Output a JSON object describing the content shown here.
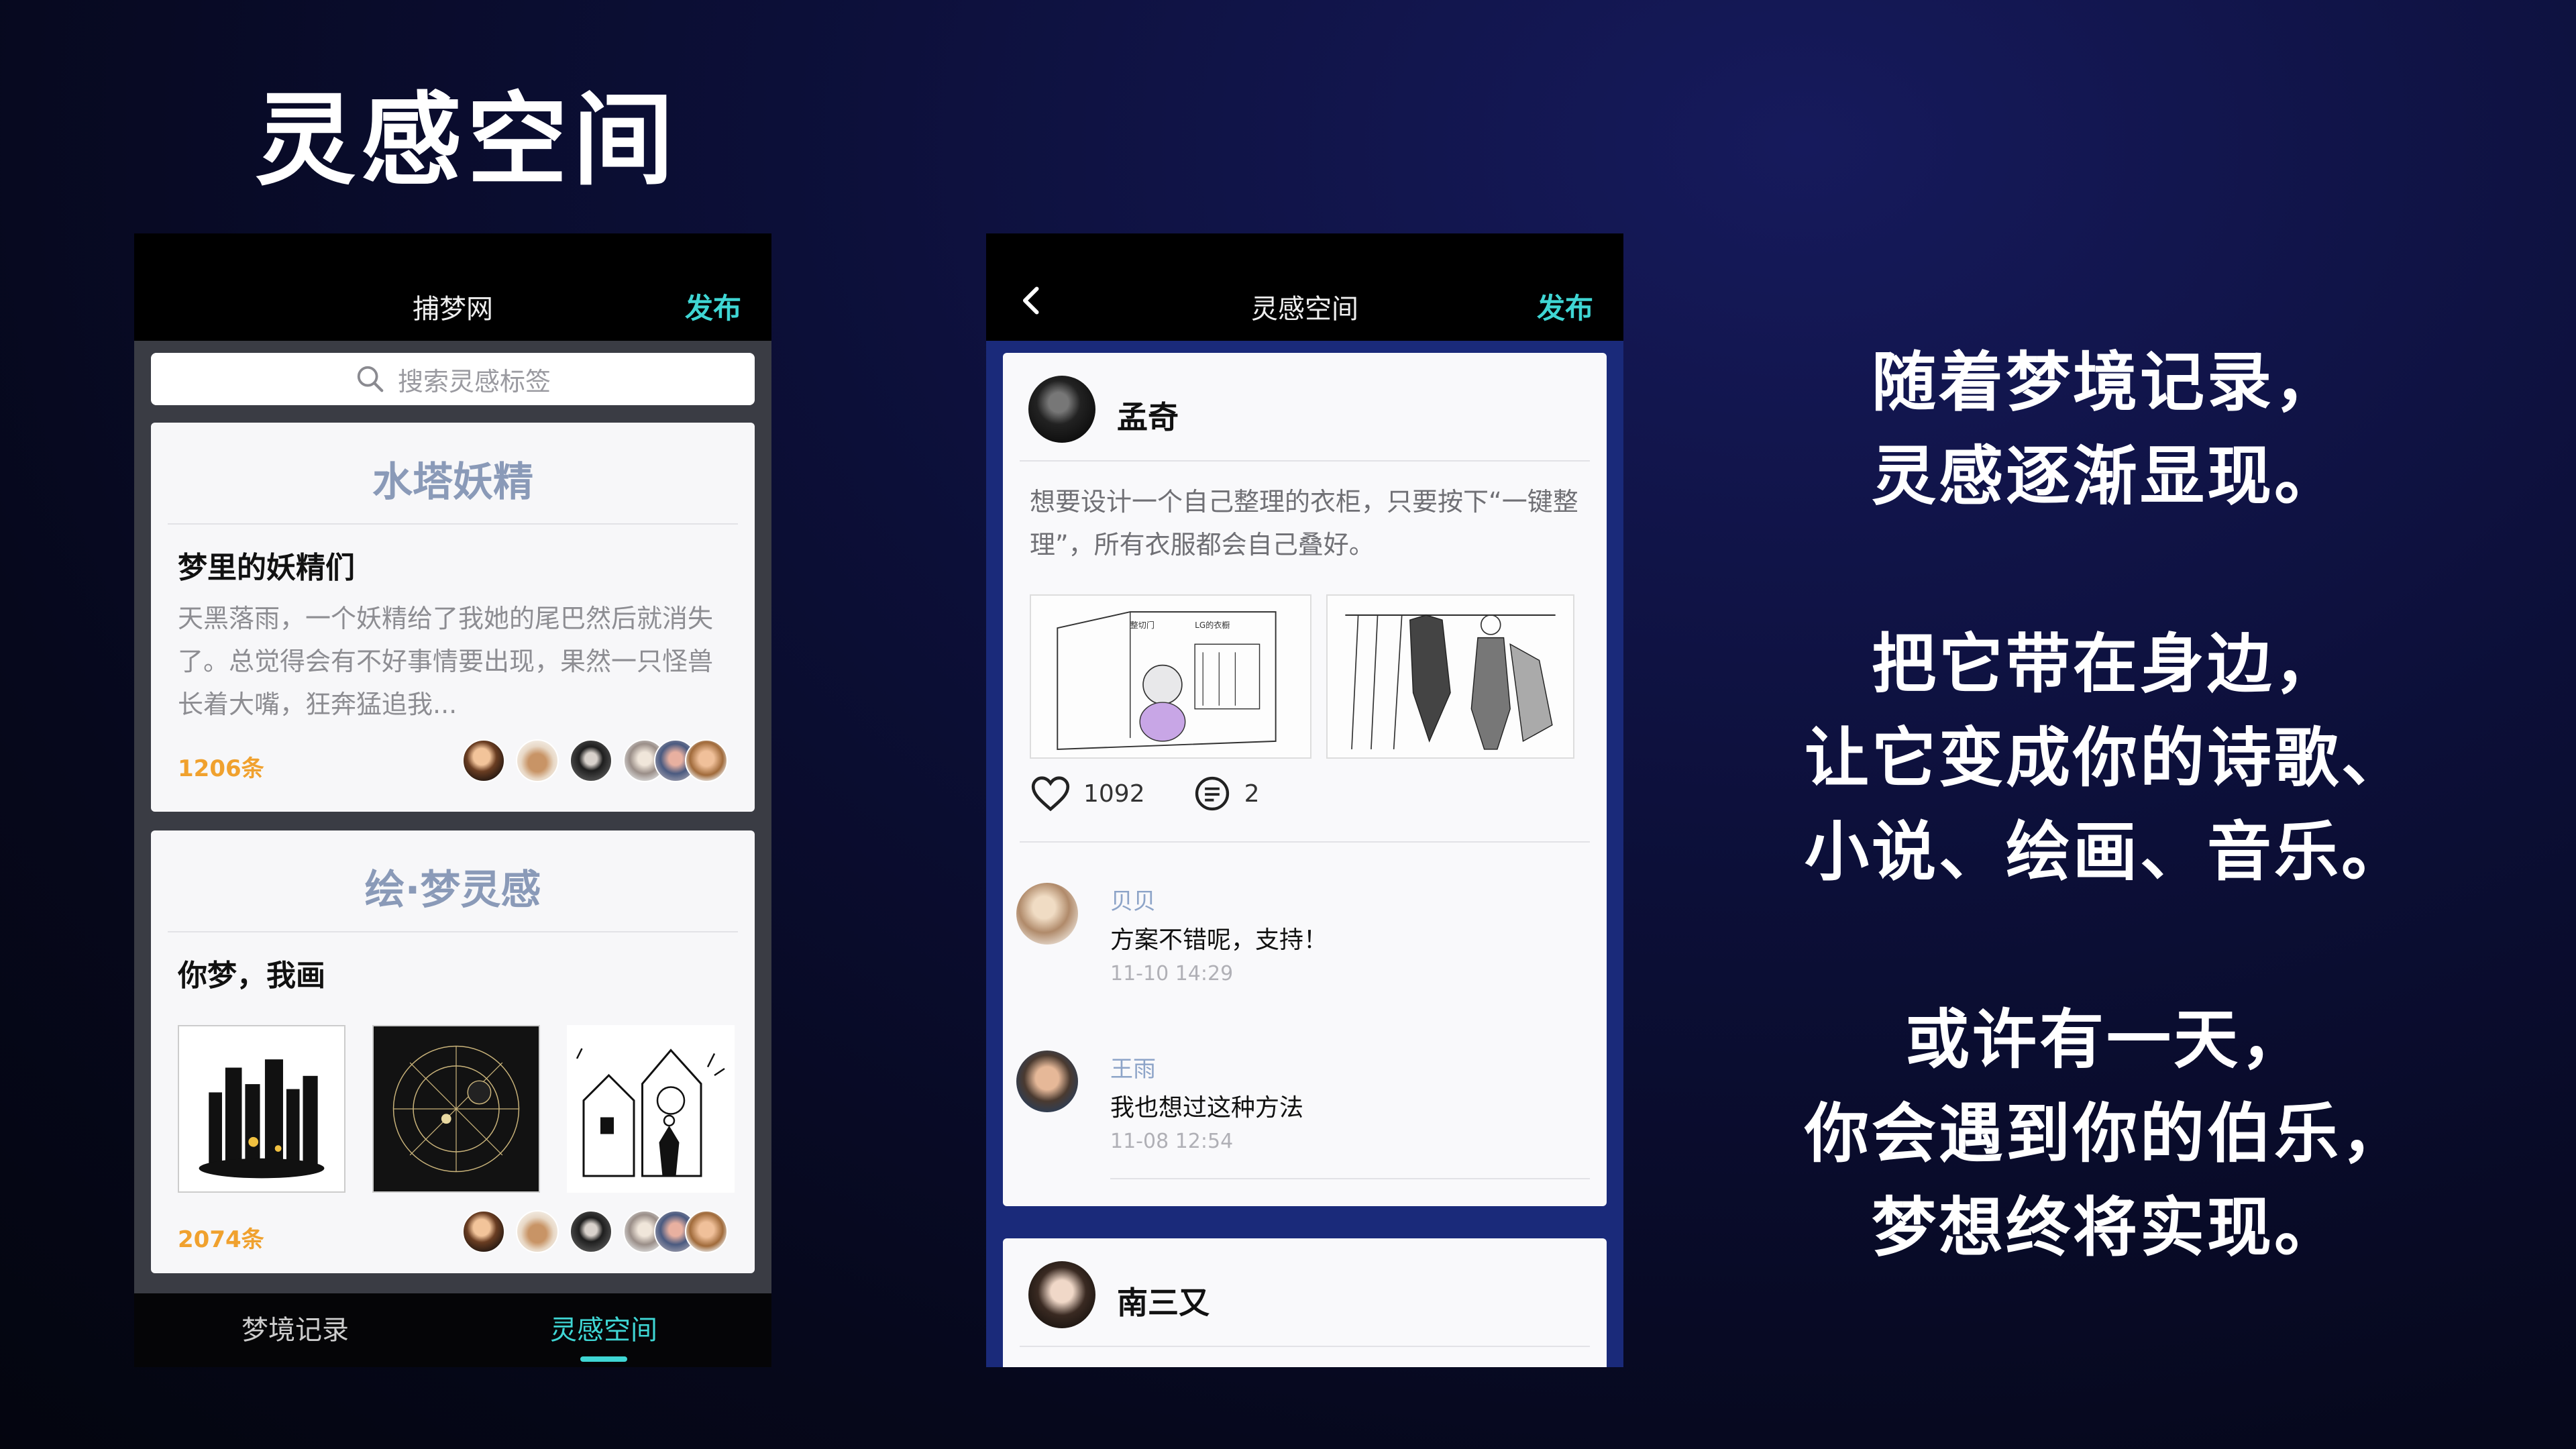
{
  "hero": {
    "title": "灵感空间"
  },
  "left_phone": {
    "nav_title": "捕梦网",
    "publish_label": "发布",
    "search_placeholder": "搜索灵感标签",
    "card1": {
      "tag": "水塔妖精",
      "heading": "梦里的妖精们",
      "body": "天黑落雨，一个妖精给了我她的尾巴然后就消失了。总觉得会有不好事情要出现，果然一只怪兽长着大嘴，狂奔猛追我...",
      "count": "1206条"
    },
    "card2": {
      "tag": "绘·梦灵感",
      "heading": "你梦，我画",
      "count": "2074条"
    },
    "tabs": {
      "dream": "梦境记录",
      "inspire": "灵感空间"
    }
  },
  "right_phone": {
    "nav_title": "灵感空间",
    "publish_label": "发布",
    "post": {
      "author": "孟奇",
      "text": "想要设计一个自己整理的衣柜，只要按下“一键整理”，所有衣服都会自己叠好。",
      "sketch_label_a": "整切门",
      "sketch_label_b": "LG的衣橱",
      "likes": "1092",
      "comments": "2"
    },
    "comments": [
      {
        "name": "贝贝",
        "text": "方案不错呢，支持！",
        "time": "11-10  14:29"
      },
      {
        "name": "王雨",
        "text": "我也想过这种方法",
        "time": "11-08  12:54"
      }
    ],
    "next_post_author": "南三又"
  },
  "side": {
    "p1": [
      "随着梦境记录，",
      "灵感逐渐显现。"
    ],
    "p2": [
      "把它带在身边，",
      "让它变成你的诗歌、",
      "小说、绘画、音乐。"
    ],
    "p3": [
      "或许有一天，",
      "你会遇到你的伯乐，",
      "梦想终将实现。"
    ]
  },
  "colors": {
    "accent": "#3fd6d4",
    "count": "#f0a12e",
    "tag": "#8a9ab8"
  }
}
